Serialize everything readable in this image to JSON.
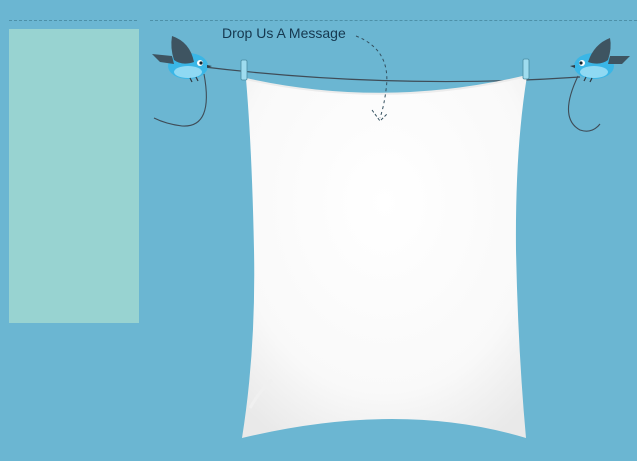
{
  "header": {
    "title": "Drop Us A Message"
  },
  "icons": {
    "left_bird": "bird-icon",
    "right_bird": "bird-icon",
    "arrow": "dashed-curved-arrow-icon",
    "left_peg": "clothespin-icon",
    "right_peg": "clothespin-icon"
  },
  "colors": {
    "background": "#6bb6d2",
    "sidebar": "#98d3d1",
    "sheet": "#ffffff",
    "heading": "#16384f",
    "bird_body": "#3ab6e6",
    "bird_wing": "#3e5461"
  }
}
